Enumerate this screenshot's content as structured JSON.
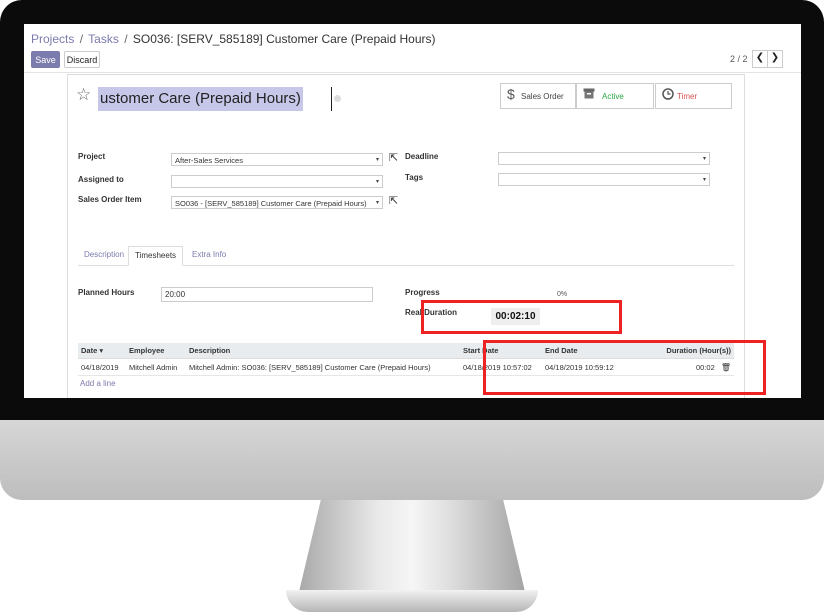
{
  "breadcrumb": {
    "items": [
      "Projects",
      "Tasks"
    ],
    "separator": "/",
    "current": "SO036: [SERV_585189] Customer Care (Prepaid Hours)"
  },
  "toolbar": {
    "save_label": "Save",
    "discard_label": "Discard"
  },
  "pager": {
    "value": "2 / 2",
    "prev": "❮",
    "next": "❯"
  },
  "title": "ustomer Care (Prepaid Hours)",
  "smart_buttons": {
    "sales_order": {
      "label": "Sales Order",
      "icon": "dollar-icon"
    },
    "active": {
      "label": "Active",
      "icon": "archive-icon"
    },
    "timer": {
      "label": "Timer",
      "icon": "clock-icon"
    }
  },
  "fields": {
    "project": {
      "label": "Project",
      "value": "After-Sales Services"
    },
    "assigned_to": {
      "label": "Assigned to",
      "value": ""
    },
    "sales_order_item": {
      "label": "Sales Order Item",
      "value": "SO036 - [SERV_585189] Customer Care (Prepaid Hours)"
    },
    "deadline": {
      "label": "Deadline",
      "value": ""
    },
    "tags": {
      "label": "Tags",
      "value": ""
    }
  },
  "tabs": [
    "Description",
    "Timesheets",
    "Extra Info"
  ],
  "timesheets": {
    "planned_hours_label": "Planned Hours",
    "planned_hours_value": "20:00",
    "progress_label": "Progress",
    "progress_value": "0%",
    "real_duration_label": "Real Duration",
    "real_duration_value": "00:02:10",
    "columns": [
      "Date ▾",
      "Employee",
      "Description",
      "Start Date",
      "End Date",
      "Duration (Hour(s))"
    ],
    "rows": [
      [
        "04/18/2019",
        "Mitchell Admin",
        "Mitchell Admin: SO036: [SERV_585189] Customer Care (Prepaid Hours)",
        "04/18/2019 10:57:02",
        "04/18/2019 10:59:12",
        "00:02"
      ]
    ],
    "add_line_label": "Add a line"
  },
  "colors": {
    "accent": "#7c7bad",
    "highlight_box": "#ee2222",
    "timer_text": "#d9534f",
    "active_text": "#28a745",
    "title_selection": "#c7c8e9"
  }
}
